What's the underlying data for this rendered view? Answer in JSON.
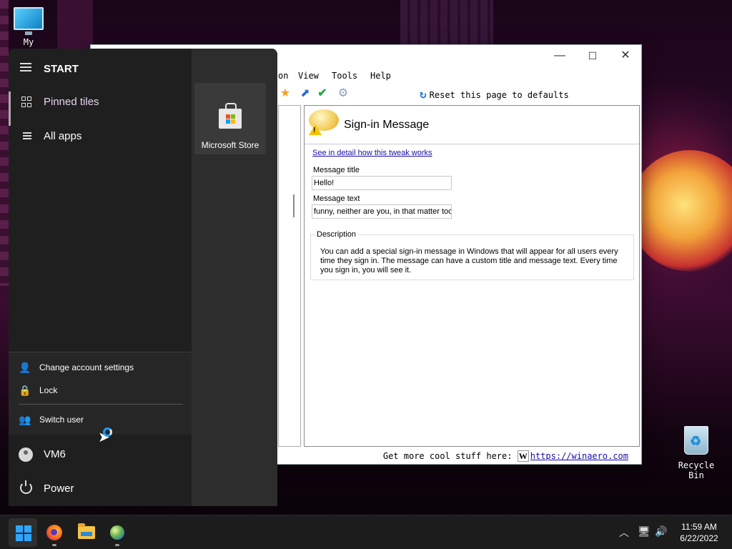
{
  "desktop": {
    "my_pc_label": "My",
    "recycle_label_1": "Recycle",
    "recycle_label_2": "Bin"
  },
  "app": {
    "menu": {
      "view": "View",
      "tools": "Tools",
      "help": "Help",
      "partial": "on"
    },
    "toolbar": {
      "reset_label": "Reset this page to defaults"
    },
    "panel": {
      "title": "Sign-in Message",
      "detail_link": "See in detail how this tweak works",
      "message_title_label": "Message title",
      "message_title_value": "Hello!",
      "message_text_label": "Message text",
      "message_text_value": "funny, neither are you, in that matter too.",
      "description_legend": "Description",
      "description_text": "You can add a special sign-in message in Windows that will appear for all users every time they sign in. The message can have a custom title and message text. Every time you sign in, you will see it."
    },
    "status": {
      "prefix": "Get more cool stuff here:",
      "w": "W",
      "link": "https://winaero.com"
    }
  },
  "start_menu": {
    "title": "START",
    "nav": [
      {
        "label": "Pinned tiles",
        "icon": "tiles-icon"
      },
      {
        "label": "All apps",
        "icon": "list-icon"
      }
    ],
    "tile": {
      "label": "Microsoft Store",
      "icon": "store-bag-icon"
    },
    "account": {
      "change_settings": "Change account settings",
      "lock": "Lock",
      "switch_user": "Switch user"
    },
    "user": "VM6",
    "power": "Power"
  },
  "taskbar": {
    "time": "11:59 AM",
    "date": "6/22/2022",
    "accent": "#2ea6ff"
  }
}
